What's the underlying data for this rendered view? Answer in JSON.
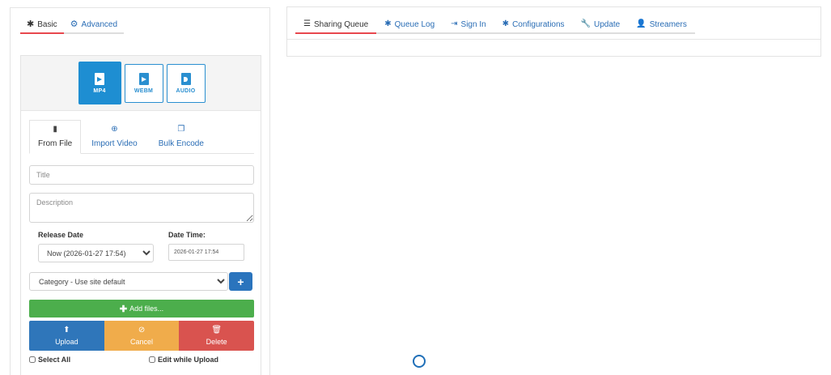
{
  "mode_tabs": [
    {
      "label": "Basic",
      "icon": "cog-icon",
      "active": true
    },
    {
      "label": "Advanced",
      "icon": "cogs-icon",
      "active": false
    }
  ],
  "formats": [
    {
      "label": "MP4",
      "active": true
    },
    {
      "label": "WEBM",
      "active": false
    },
    {
      "label": "AUDIO",
      "active": false
    }
  ],
  "source_tabs": [
    {
      "label": "From File",
      "icon": "file-icon",
      "active": true
    },
    {
      "label": "Import Video",
      "icon": "globe-icon",
      "active": false
    },
    {
      "label": "Bulk Encode",
      "icon": "copy-files-icon",
      "active": false
    }
  ],
  "form": {
    "title_placeholder": "Title",
    "description_placeholder": "Description",
    "release_date_label": "Release Date",
    "release_date_value": "Now (2026-01-27 17:54)",
    "datetime_label": "Date Time:",
    "datetime_value": "2026-01-27 17:54",
    "category_value": "Category - Use site default",
    "category_add_label": "+"
  },
  "buttons": {
    "add_files": "Add files...",
    "upload": "Upload",
    "cancel": "Cancel",
    "delete": "Delete"
  },
  "checkboxes": {
    "select_all": "Select All",
    "edit_while_upload": "Edit while Upload"
  },
  "right_tabs": [
    {
      "label": "Sharing Queue",
      "icon": "list-icon",
      "active": true
    },
    {
      "label": "Queue Log",
      "icon": "cog-icon",
      "active": false
    },
    {
      "label": "Sign In",
      "icon": "sign-in-icon",
      "active": false
    },
    {
      "label": "Configurations",
      "icon": "cog-icon",
      "active": false
    },
    {
      "label": "Update",
      "icon": "wrench-icon",
      "active": false
    },
    {
      "label": "Streamers",
      "icon": "user-icon",
      "active": false
    }
  ],
  "colors": {
    "accent_underline": "#e8474e",
    "primary_blue": "#1e8ed2",
    "success_green": "#4cae4c",
    "warning_orange": "#f0ac4b",
    "danger_red": "#d9534f"
  }
}
